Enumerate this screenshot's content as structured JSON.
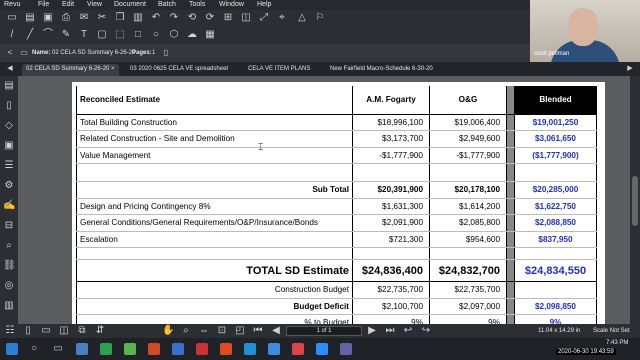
{
  "menu": [
    "Revu",
    "File",
    "Edit",
    "View",
    "Document",
    "Batch",
    "Tools",
    "Window",
    "Help"
  ],
  "doc_info": {
    "name_label": "Name:",
    "name_value": "02 CELA SD Summary 6-26-20",
    "pages_label": "Pages:",
    "pages_value": "1"
  },
  "webcam": {
    "person_name": "scott pellman"
  },
  "tabs": [
    {
      "label": "02 CELA SD Summary 6-26-20",
      "active": true
    },
    {
      "label": "03 2020 0625 CELA VE spreadsheet",
      "active": false
    },
    {
      "label": "CELA VE ITEM PLANS",
      "active": false
    },
    {
      "label": "New Fairfield Macro-Schedule 6-30-20",
      "active": false
    }
  ],
  "table": {
    "headers": {
      "desc": "Reconciled Estimate",
      "am": "A.M. Fogarty",
      "og": "O&G",
      "blended": "Blended"
    },
    "rows": [
      {
        "type": "item",
        "desc": "Total Building Construction",
        "am": "$18,996,100",
        "og": "$19,006,400",
        "blended": "$19,001,250"
      },
      {
        "type": "item",
        "desc": "Related Construction - Site and Demolition",
        "am": "$3,173,700",
        "og": "$2,949,600",
        "blended": "$3,061,650"
      },
      {
        "type": "item",
        "desc": "Value Management",
        "am": "-$1,777,900",
        "og": "-$1,777,900",
        "blended": "($1,777,900)"
      },
      {
        "type": "spacer",
        "desc": "",
        "am": "",
        "og": "",
        "blended": ""
      },
      {
        "type": "sub",
        "desc": "Sub Total",
        "am": "$20,391,900",
        "og": "$20,178,100",
        "blended": "$20,285,000"
      },
      {
        "type": "item",
        "desc": "Design and Pricing Contingency 8%",
        "am": "$1,631,300",
        "og": "$1,614,200",
        "blended": "$1,622,750"
      },
      {
        "type": "item",
        "desc": "General Conditions/General Requirements/O&P/Insurance/Bonds",
        "am": "$2,091,900",
        "og": "$2,085,800",
        "blended": "$2,088,850"
      },
      {
        "type": "item",
        "desc": "Escalation",
        "am": "$721,300",
        "og": "$954,600",
        "blended": "$837,950"
      },
      {
        "type": "spacer2",
        "desc": "",
        "am": "",
        "og": "",
        "blended": ""
      },
      {
        "type": "total",
        "desc": "TOTAL SD Estimate",
        "am": "$24,836,400",
        "og": "$24,832,700",
        "blended": "$24,834,550"
      },
      {
        "type": "bud",
        "desc": "Construction Budget",
        "am": "$22,735,700",
        "og": "$22,735,700",
        "blended": ""
      },
      {
        "type": "bud def",
        "desc": "Budget Deficit",
        "am": "$2,100,700",
        "og": "$2,097,000",
        "blended": "$2,098,850"
      },
      {
        "type": "bud",
        "desc": "% to Budget",
        "am": "9%",
        "og": "9%",
        "blended": "9%"
      }
    ]
  },
  "status": {
    "page": "1 of 1",
    "dimensions": "11.04 x 14.29 in",
    "scale": "Scale Not Set"
  },
  "taskbar": {
    "time": "7:43 PM",
    "date": "2020-06-30 19:43:59"
  }
}
